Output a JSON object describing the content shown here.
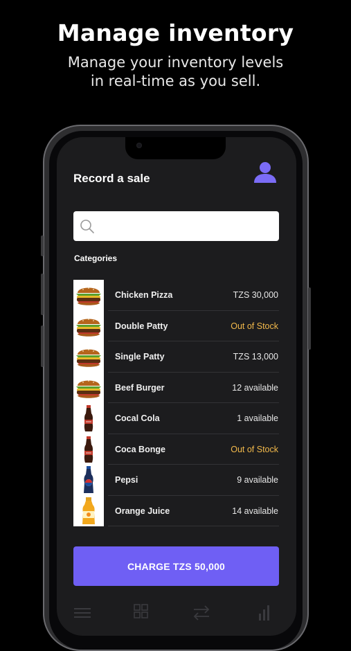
{
  "promo": {
    "title": "Manage inventory",
    "subtitle_line1": "Manage your inventory levels",
    "subtitle_line2": "in real-time as you sell."
  },
  "screen": {
    "title": "Record a sale",
    "search": {
      "placeholder": "",
      "value": ""
    },
    "categories_label": "Categories",
    "products": [
      {
        "name": "Chicken Pizza",
        "status": "TZS 30,000",
        "status_type": "price",
        "icon": "burger-image"
      },
      {
        "name": "Double Patty",
        "status": "Out of Stock",
        "status_type": "out",
        "icon": "burger-image"
      },
      {
        "name": "Single Patty",
        "status": "TZS 13,000",
        "status_type": "price",
        "icon": "burger-image"
      },
      {
        "name": "Beef Burger",
        "status": "12 available",
        "status_type": "stock",
        "icon": "burger-image"
      },
      {
        "name": "Cocal Cola",
        "status": "1 available",
        "status_type": "stock",
        "icon": "cola-bottle-image"
      },
      {
        "name": "Coca Bonge",
        "status": "Out of Stock",
        "status_type": "out",
        "icon": "cola-bottle-image"
      },
      {
        "name": "Pepsi",
        "status": "9 available",
        "status_type": "stock",
        "icon": "pepsi-bottle-image"
      },
      {
        "name": "Orange Juice",
        "status": "14 available",
        "status_type": "stock",
        "icon": "juice-bottle-image"
      }
    ],
    "charge_button": "CHARGE TZS 50,000",
    "tabs": [
      "menu-icon",
      "grid-icon",
      "transfer-icon",
      "bar-chart-icon"
    ]
  },
  "colors": {
    "accent": "#6f5ff4",
    "out_of_stock": "#f2b94b",
    "screen_bg": "#1c1c1e"
  }
}
